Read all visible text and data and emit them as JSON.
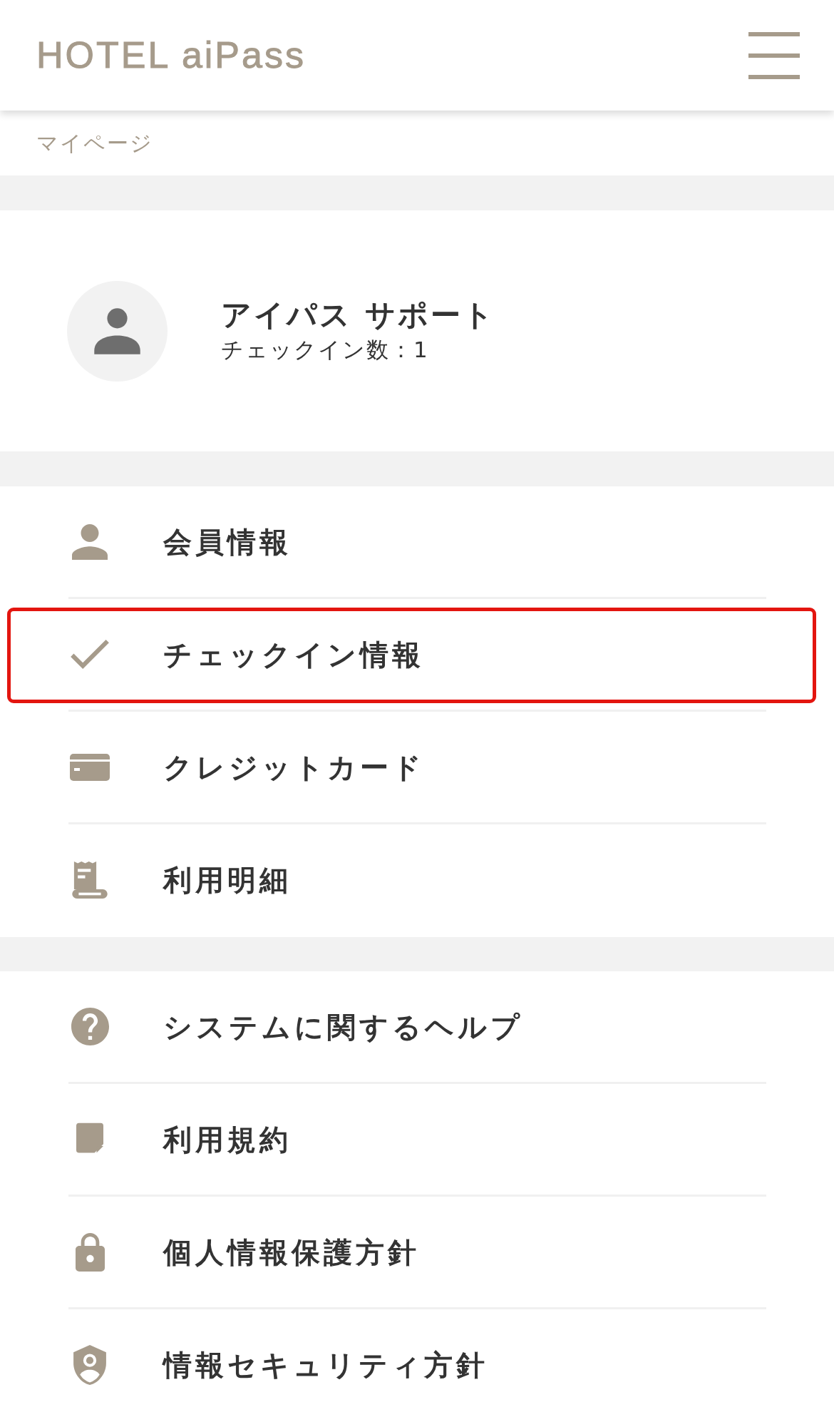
{
  "header": {
    "logo": "HOTEL aiPass"
  },
  "breadcrumb": "マイページ",
  "profile": {
    "name": "アイパス サポート",
    "checkin_count": "チェックイン数：1"
  },
  "menu_groups": [
    {
      "items": [
        {
          "kind": "person",
          "label": "会員情報",
          "highlighted": false
        },
        {
          "kind": "check",
          "label": "チェックイン情報",
          "highlighted": true
        },
        {
          "kind": "card",
          "label": "クレジットカード",
          "highlighted": false
        },
        {
          "kind": "receipt",
          "label": "利用明細",
          "highlighted": false
        }
      ]
    },
    {
      "items": [
        {
          "kind": "help",
          "label": "システムに関するヘルプ",
          "highlighted": false
        },
        {
          "kind": "note",
          "label": "利用規約",
          "highlighted": false
        },
        {
          "kind": "lock",
          "label": "個人情報保護方針",
          "highlighted": false
        },
        {
          "kind": "shield",
          "label": "情報セキュリティ方針",
          "highlighted": false
        }
      ]
    }
  ]
}
